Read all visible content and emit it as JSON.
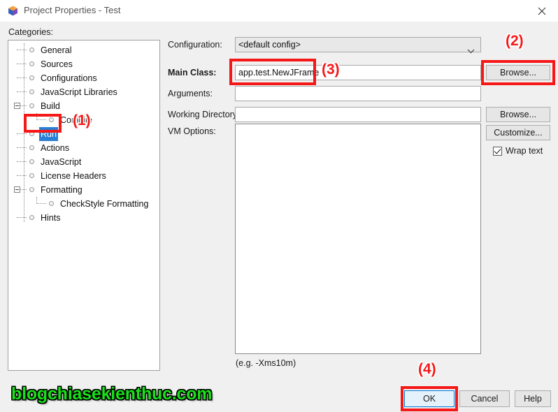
{
  "window": {
    "title": "Project Properties - Test",
    "icon": "netbeans-cube-icon",
    "close_label": "close-icon"
  },
  "sidebar": {
    "label": "Categories:",
    "items": [
      {
        "label": "General",
        "depth": 0,
        "expander": "none"
      },
      {
        "label": "Sources",
        "depth": 0,
        "expander": "none"
      },
      {
        "label": "Configurations",
        "depth": 0,
        "expander": "none"
      },
      {
        "label": "JavaScript Libraries",
        "depth": 0,
        "expander": "none"
      },
      {
        "label": "Build",
        "depth": 0,
        "expander": "collapse"
      },
      {
        "label": "Compile",
        "depth": 1,
        "expander": "none"
      },
      {
        "label": "Run",
        "depth": 0,
        "expander": "none",
        "selected": true
      },
      {
        "label": "Actions",
        "depth": 0,
        "expander": "none"
      },
      {
        "label": "JavaScript",
        "depth": 0,
        "expander": "none"
      },
      {
        "label": "License Headers",
        "depth": 0,
        "expander": "none"
      },
      {
        "label": "Formatting",
        "depth": 0,
        "expander": "collapse"
      },
      {
        "label": "CheckStyle Formatting",
        "depth": 1,
        "expander": "none"
      },
      {
        "label": "Hints",
        "depth": 0,
        "expander": "none"
      }
    ]
  },
  "form": {
    "configuration": {
      "label": "Configuration:",
      "value": "<default config>",
      "arrow_icon": "chevron-down-icon"
    },
    "main_class": {
      "label": "Main Class:",
      "value": "app.test.NewJFrame",
      "browse_label": "Browse..."
    },
    "arguments": {
      "label": "Arguments:",
      "value": ""
    },
    "working_directory": {
      "label": "Working Directory:",
      "value": "",
      "browse_label": "Browse..."
    },
    "vm_options": {
      "label": "VM Options:",
      "value": "",
      "customize_label": "Customize...",
      "wrap_text_label": "Wrap text",
      "wrap_text_checked": true,
      "hint": "(e.g. -Xms10m)"
    }
  },
  "footer": {
    "ok_label": "OK",
    "cancel_label": "Cancel",
    "help_label": "Help"
  },
  "annotations": {
    "one": "(1)",
    "two": "(2)",
    "three": "(3)",
    "four": "(4)"
  },
  "watermark": {
    "text": "blogchiasekienthuc.com"
  },
  "colors": {
    "accent": "#2a7fd4",
    "annotation": "#f61717",
    "watermark": "#19e019",
    "window_bg": "#f0f0f0"
  }
}
